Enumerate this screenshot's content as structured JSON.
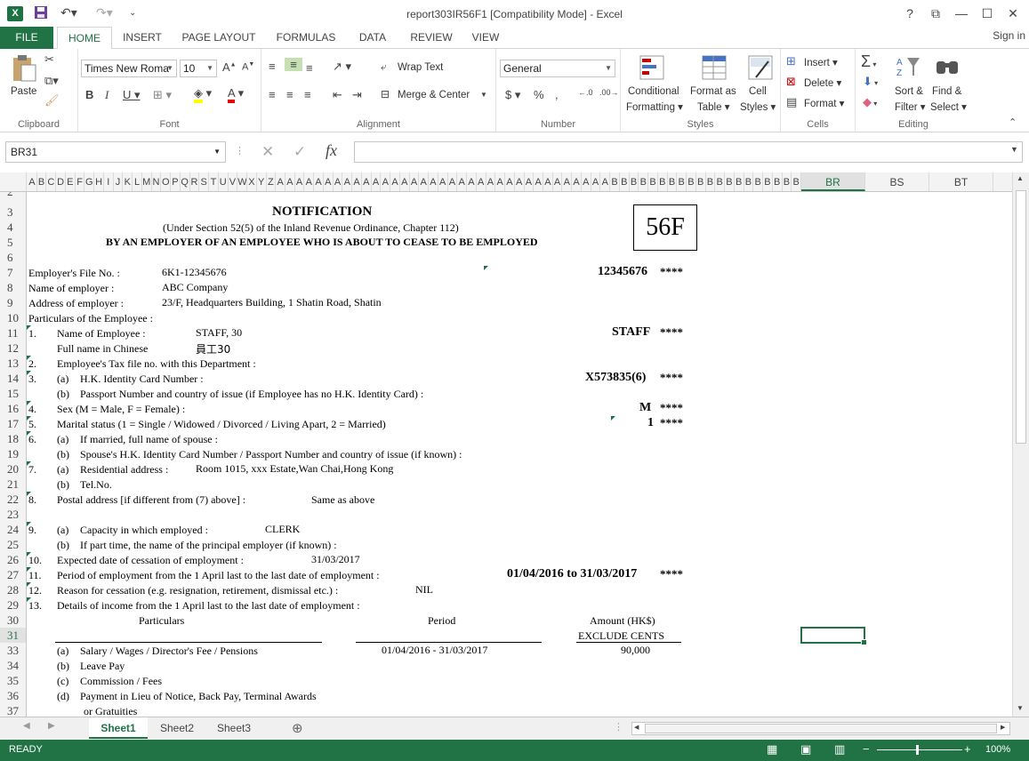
{
  "app": {
    "logo": "X",
    "title": "report303IR56F1  [Compatibility Mode] - Excel",
    "window_buttons": [
      "?",
      "⧉",
      "—",
      "☐",
      "✕"
    ]
  },
  "ribbon_tabs": [
    "FILE",
    "HOME",
    "INSERT",
    "PAGE LAYOUT",
    "FORMULAS",
    "DATA",
    "REVIEW",
    "VIEW"
  ],
  "signin": "Sign in",
  "ribbon": {
    "clipboard": {
      "paste": "Paste",
      "label": "Clipboard"
    },
    "font": {
      "name": "Times New Roma",
      "size": "10",
      "label": "Font"
    },
    "alignment": {
      "wrap": "Wrap Text",
      "merge": "Merge & Center",
      "label": "Alignment"
    },
    "number": {
      "format": "General",
      "label": "Number"
    },
    "styles": {
      "conditional1": "Conditional",
      "conditional2": "Formatting",
      "table1": "Format as",
      "table2": "Table",
      "cell1": "Cell",
      "cell2": "Styles",
      "label": "Styles"
    },
    "cells": {
      "insert": "Insert",
      "delete": "Delete",
      "format": "Format",
      "label": "Cells"
    },
    "editing": {
      "sort1": "Sort &",
      "sort2": "Filter",
      "find1": "Find &",
      "find2": "Select",
      "label": "Editing"
    }
  },
  "namebox": "BR31",
  "columns": [
    "A",
    "B",
    "C",
    "D",
    "E",
    "F",
    "G",
    "H",
    "I",
    "J",
    "K",
    "L",
    "M",
    "N",
    "O",
    "P",
    "Q",
    "R",
    "S",
    "T",
    "U",
    "V",
    "W",
    "X",
    "Y",
    "Z",
    "A",
    "A",
    "A",
    "A",
    "A",
    "A",
    "A",
    "A",
    "A",
    "A",
    "A",
    "A",
    "A",
    "A",
    "A",
    "A",
    "A",
    "A",
    "A",
    "A",
    "A",
    "A",
    "A",
    "A",
    "A",
    "A",
    "A",
    "A",
    "A",
    "A",
    "A",
    "A",
    "A",
    "A",
    "A",
    "B",
    "B",
    "B",
    "B",
    "B",
    "B",
    "B",
    "B",
    "B",
    "B",
    "B",
    "B",
    "B",
    "B",
    "B",
    "B",
    "B",
    "B",
    "B",
    "B"
  ],
  "wide_columns": [
    "BR",
    "BS",
    "BT"
  ],
  "rows": [
    "2",
    "3",
    "4",
    "5",
    "6",
    "7",
    "8",
    "9",
    "10",
    "11",
    "12",
    "13",
    "14",
    "15",
    "16",
    "17",
    "18",
    "19",
    "20",
    "21",
    "22",
    "23",
    "24",
    "25",
    "26",
    "27",
    "28",
    "29",
    "30",
    "31",
    "33",
    "34",
    "35",
    "36",
    "37"
  ],
  "form": {
    "title": "NOTIFICATION",
    "subtitle": "(Under Section 52(5) of the Inland Revenue Ordinance, Chapter 112)",
    "heading": "BY AN EMPLOYER OF AN EMPLOYEE WHO IS ABOUT TO CEASE TO BE EMPLOYED",
    "form_no": "56F",
    "file_no_label": "Employer's File No. :",
    "file_no": "6K1-12345676",
    "file_no_right": "12345676",
    "stars": "****",
    "employer_label": "Name of employer :",
    "employer": "ABC Company",
    "address_label": "Address of employer :",
    "address": "23/F, Headquarters Building, 1 Shatin Road, Shatin",
    "particulars": "Particulars of the Employee :",
    "n1": "1.",
    "name_label": "Name of Employee :",
    "name": "STAFF, 30",
    "name_right": "STAFF",
    "chinese_label": "Full name in Chinese",
    "chinese": "員工30",
    "n2": "2.",
    "taxfile_label": "Employee's Tax file no. with this Department :",
    "n3": "3.",
    "a": "(a)",
    "b": "(b)",
    "c": "(c)",
    "d": "(d)",
    "hkid_label": "H.K. Identity Card Number :",
    "hkid": "X573835(6)",
    "passport_label": "Passport Number and country of issue (if Employee has no H.K. Identity Card) :",
    "n4": "4.",
    "sex_label": "Sex (M = Male, F = Female) :",
    "sex": "M",
    "n5": "5.",
    "marital_label": "Marital status (1 = Single / Widowed / Divorced / Living Apart, 2 = Married)",
    "marital": "1",
    "n6": "6.",
    "spouse_label": "If married, full name of spouse :",
    "spouse_id_label": "Spouse's H.K. Identity Card Number / Passport Number and country of issue (if known) :",
    "n7": "7.",
    "res_label": "Residential address :",
    "res": "Room 1015, xxx Estate,Wan Chai,Hong Kong",
    "tel_label": "Tel.No.",
    "n8": "8.",
    "postal_label": "Postal address [if different from (7) above] :",
    "postal": "Same as above",
    "n9": "9.",
    "capacity_label": "Capacity in which employed :",
    "capacity": "CLERK",
    "principal_label": "If part time, the name of the principal employer (if known) :",
    "n10": "10.",
    "cessation_label": "Expected date of cessation of employment :",
    "cessation": "31/03/2017",
    "n11": "11.",
    "period_label": "Period of employment from the 1 April last to the last date of employment :",
    "period_right": "01/04/2016 to 31/03/2017",
    "n12": "12.",
    "reason_label": "Reason for cessation (e.g. resignation, retirement, dismissal etc.) :",
    "reason": "NIL",
    "n13": "13.",
    "income_label": "Details of income from the 1 April last to the last date of employment :",
    "col_particulars": "Particulars",
    "col_period": "Period",
    "col_amount": "Amount (HK$)",
    "col_exclude": "EXCLUDE CENTS",
    "salary_label": "Salary / Wages / Director's Fee / Pensions",
    "salary_period": "01/04/2016 - 31/03/2017",
    "salary_amount": "90,000",
    "leave_label": "Leave Pay",
    "commission_label": "Commission / Fees",
    "notice_label": "Payment in Lieu of Notice, Back Pay, Terminal Awards",
    "gratuities_label": "or Gratuities"
  },
  "sheet_tabs": [
    "Sheet1",
    "Sheet2",
    "Sheet3"
  ],
  "status": {
    "ready": "READY",
    "zoom": "100%"
  }
}
